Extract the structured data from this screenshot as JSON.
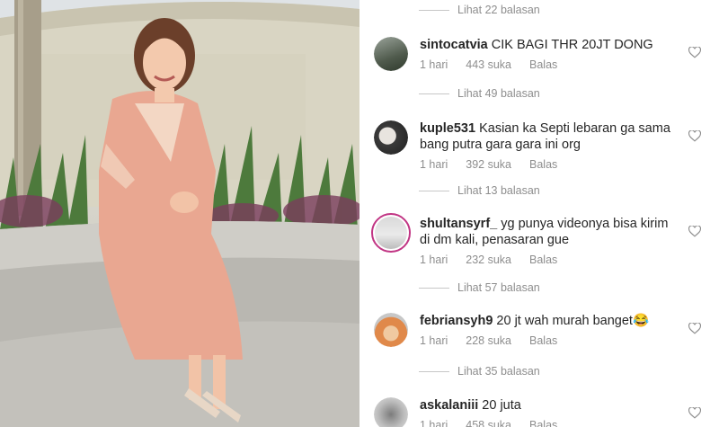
{
  "replies": [
    {
      "label": "Lihat 22 balasan"
    },
    {
      "label": "Lihat 49 balasan"
    },
    {
      "label": "Lihat 13 balasan"
    },
    {
      "label": "Lihat 57 balasan"
    },
    {
      "label": "Lihat 35 balasan"
    }
  ],
  "comments": [
    {
      "username": "sintocatvia",
      "text": "CIK BAGI THR 20JT DONG",
      "time": "1 hari",
      "likes": "443 suka",
      "reply": "Balas"
    },
    {
      "username": "kuple531",
      "text": "Kasian ka Septi lebaran ga sama bang putra gara gara ini org",
      "time": "1 hari",
      "likes": "392 suka",
      "reply": "Balas"
    },
    {
      "username": "shultansyrf_",
      "text": "yg punya videonya bisa kirim di dm kali, penasaran gue",
      "time": "1 hari",
      "likes": "232 suka",
      "reply": "Balas"
    },
    {
      "username": "febriansyh9",
      "text": "20 jt wah murah banget😂",
      "time": "1 hari",
      "likes": "228 suka",
      "reply": "Balas"
    },
    {
      "username": "askalaniii",
      "text": "20 juta",
      "time": "1 hari",
      "likes": "458 suka",
      "reply": "Balas"
    }
  ],
  "icons": {
    "like": "heart-outline-icon"
  },
  "colors": {
    "meta": "#8e8e8e",
    "text": "#262626",
    "story_ring": "#c13584"
  }
}
